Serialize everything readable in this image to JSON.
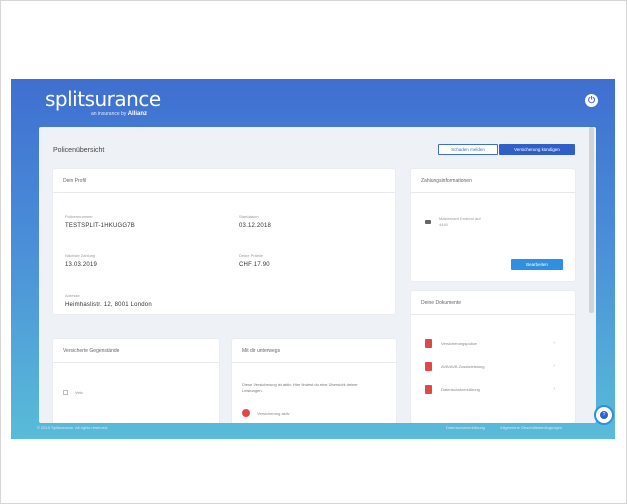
{
  "brand": {
    "logo": "splitsurance",
    "sub_prefix": "an insurance by",
    "sub_brand": "Allianz"
  },
  "header": {
    "power_glyph": "⏻"
  },
  "page": {
    "title": "Policenübersicht",
    "btn_outline": "Schaden melden",
    "btn_solid": "Versicherung kündigen"
  },
  "info_card": {
    "title": "Dein Profil",
    "fields": [
      {
        "label": "Policennummer",
        "value": "TESTSPLIT-1HKUGG7B"
      },
      {
        "label": "Startdatum",
        "value": "03.12.2018"
      },
      {
        "label": "Nächste Zahlung",
        "value": "13.03.2019"
      },
      {
        "label": "Deine Prämie",
        "value": "CHF 17.90"
      },
      {
        "label": "Adresse",
        "value": "Heimhaslistr. 12, 8001 London"
      }
    ]
  },
  "payment_card": {
    "title": "Zahlungsinformationen",
    "line1": "Mastercard Endend auf",
    "line2": "4440",
    "edit_label": "Bearbeiten"
  },
  "docs_card": {
    "title": "Deine Dokumente",
    "items": [
      {
        "name": "Versicherungspolice",
        "arrow": "›"
      },
      {
        "name": "AVB/AVB Zusatzleistung",
        "arrow": "›"
      },
      {
        "name": "Datenschutzerklärung",
        "arrow": "›"
      }
    ]
  },
  "insured_card": {
    "title": "Versicherte Gegenstände",
    "item": "Velo"
  },
  "status_card": {
    "title": "Mit dir unterwegs",
    "text": "Diese Versicherung ist aktiv. Hier findest du eine Übersicht deiner Leistungen.",
    "status": "Versicherung aktiv"
  },
  "footer": {
    "left": "© 2019 Splitsurance. All rights reserved.",
    "right1": "Datenschutzerklärung",
    "right2": "Allgemeine Geschäftsbedingungen"
  },
  "chat": {
    "glyph": "?"
  }
}
